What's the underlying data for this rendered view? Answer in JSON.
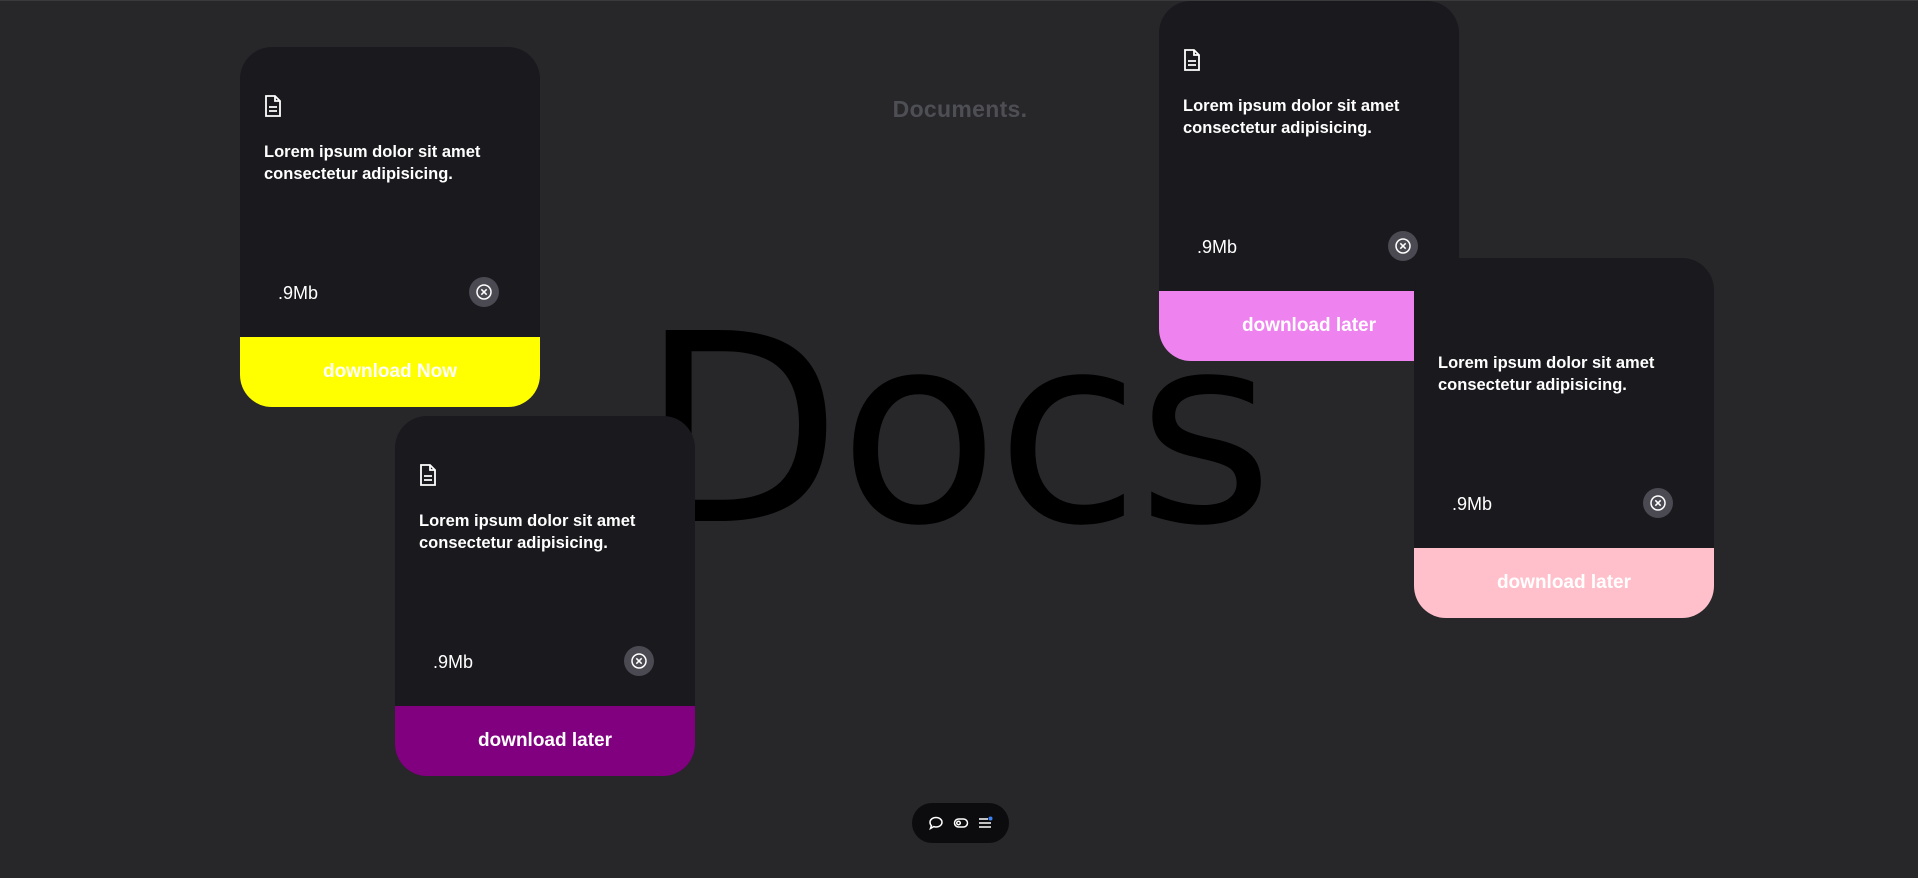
{
  "page": {
    "heading": "Documents.",
    "hero": "Docs"
  },
  "cards": [
    {
      "description": "Lorem ipsum dolor sit amet consectetur adipisicing.",
      "size": ".9Mb",
      "button_label": "download Now",
      "button_color": "#ffff00",
      "icon": "document-icon"
    },
    {
      "description": "Lorem ipsum dolor sit amet consectetur adipisicing.",
      "size": ".9Mb",
      "button_label": "download later",
      "button_color": "#800080",
      "icon": "document-icon"
    },
    {
      "description": "Lorem ipsum dolor sit amet consectetur adipisicing.",
      "size": ".9Mb",
      "button_label": "download later",
      "button_color": "#ee82ee",
      "icon": "document-icon"
    },
    {
      "description": "Lorem ipsum dolor sit amet consectetur adipisicing.",
      "size": ".9Mb",
      "button_label": "download later",
      "button_color": "#ffc0cb",
      "icon": "document-icon"
    }
  ],
  "dock": {
    "items": [
      "chat-icon",
      "toggle-icon",
      "menu-icon"
    ],
    "notification_color": "#3b82f6"
  },
  "colors": {
    "background": "#27272a",
    "card": "#1a191e"
  }
}
